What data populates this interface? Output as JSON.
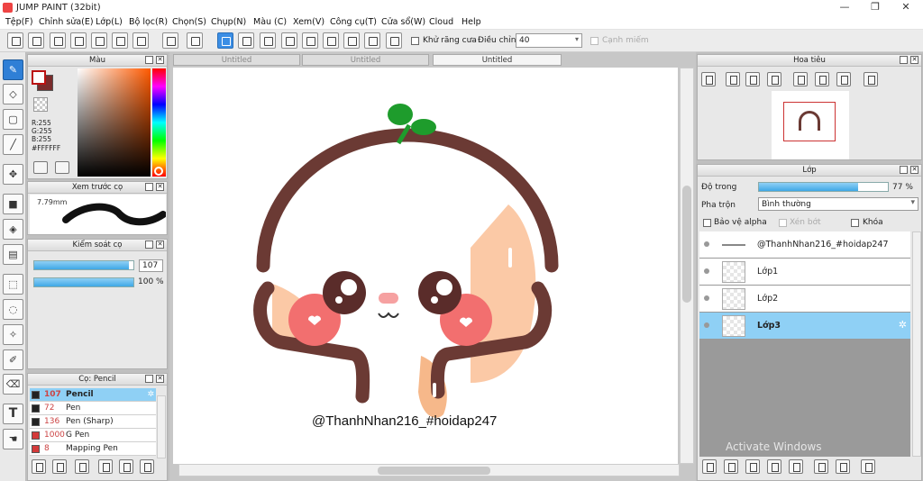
{
  "window": {
    "title": "JUMP PAINT (32bit)",
    "min": "—",
    "max": "❐",
    "close": "✕"
  },
  "menu": [
    "Tệp(F)",
    "Chỉnh sửa(E)",
    "Lớp(L)",
    "Bộ lọc(R)",
    "Chọn(S)",
    "Chụp(N)",
    "Màu (C)",
    "Xem(V)",
    "Công cụ(T)",
    "Cửa sổ(W)",
    "Cloud",
    "Help"
  ],
  "toolbar": {
    "antialias_label": "Khử răng cưa",
    "adjust_label": "Điều chỉnh",
    "adjust_value": "40",
    "edge_label": "Cạnh miếm"
  },
  "color_panel": {
    "title": "Màu",
    "r": "R:255",
    "g": "G:255",
    "b": "B:255",
    "hex": "#FFFFFF",
    "fg": "#ffffff",
    "bg": "#7a2c2c"
  },
  "preview_panel": {
    "title": "Xem trước cọ",
    "size": "7.79mm"
  },
  "brush_control": {
    "title": "Kiểm soát cọ",
    "size_value": "107",
    "size_fill": 0.95,
    "opacity_value": "100 %",
    "opacity_fill": 1.0
  },
  "brush_panel": {
    "title": "Cọ: Pencil",
    "items": [
      {
        "num": "107",
        "name": "Pencil",
        "color": "#222222",
        "selected": true
      },
      {
        "num": "72",
        "name": "Pen",
        "color": "#222222",
        "selected": false
      },
      {
        "num": "136",
        "name": "Pen (Sharp)",
        "color": "#222222",
        "selected": false
      },
      {
        "num": "1000",
        "name": "G Pen",
        "color": "#d43a3a",
        "selected": false
      },
      {
        "num": "8",
        "name": "Mapping Pen",
        "color": "#d43a3a",
        "selected": false
      }
    ]
  },
  "tabs": [
    "Untitled",
    "Untitled",
    "Untitled"
  ],
  "canvas": {
    "watermark": "@ThanhNhan216_#hoidap247"
  },
  "navigator": {
    "title": "Hoa tiêu"
  },
  "layer_panel": {
    "title": "Lớp",
    "opacity_label": "Độ trong",
    "opacity_value": "77 %",
    "opacity_fill": 0.77,
    "blend_label": "Pha trộn",
    "blend_value": "Bình thường",
    "alpha_label": "Bảo vệ alpha",
    "clip_label": "Xén bớt",
    "lock_label": "Khóa",
    "layers": [
      {
        "name": "@ThanhNhan216_#hoidap247",
        "selected": false
      },
      {
        "name": "Lớp1",
        "selected": false
      },
      {
        "name": "Lớp2",
        "selected": false
      },
      {
        "name": "Lớp3",
        "selected": true
      }
    ]
  },
  "os_watermark": "Activate Windows"
}
